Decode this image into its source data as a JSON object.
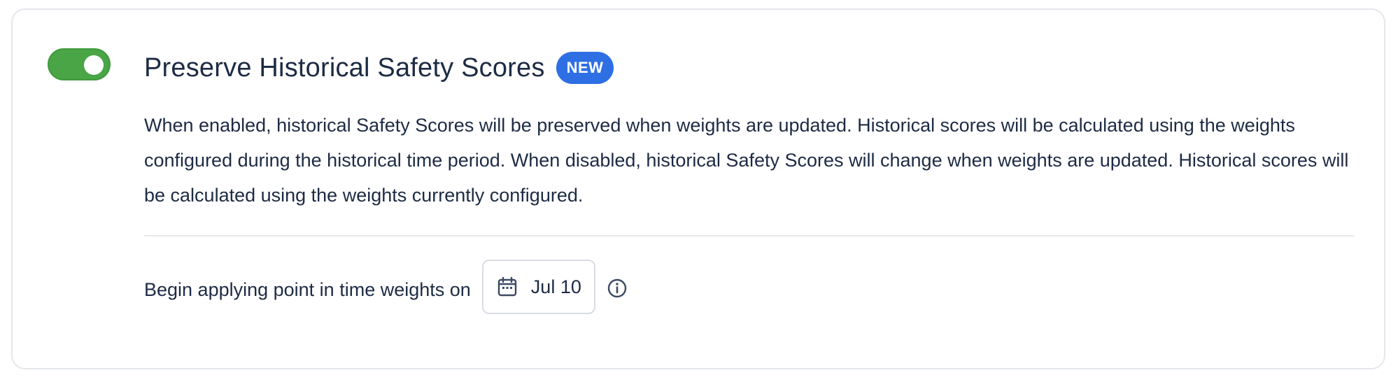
{
  "setting": {
    "enabled": true,
    "title": "Preserve Historical Safety Scores",
    "badge": "NEW",
    "description": "When enabled, historical Safety Scores will be preserved when weights are updated. Historical scores will be calculated using the weights configured during the historical time period. When disabled, historical Safety Scores will change when weights are updated. Historical scores will be calculated using the weights currently configured.",
    "apply_label": "Begin applying point in time weights on",
    "date_value": "Jul 10"
  },
  "icons": {
    "toggle": "toggle-switch",
    "date": "calendar-icon",
    "info": "info-icon"
  },
  "colors": {
    "toggle_on": "#4aa547",
    "badge_bg": "#2f6fe4",
    "text": "#1d2b44",
    "border": "#e4e7ec"
  }
}
